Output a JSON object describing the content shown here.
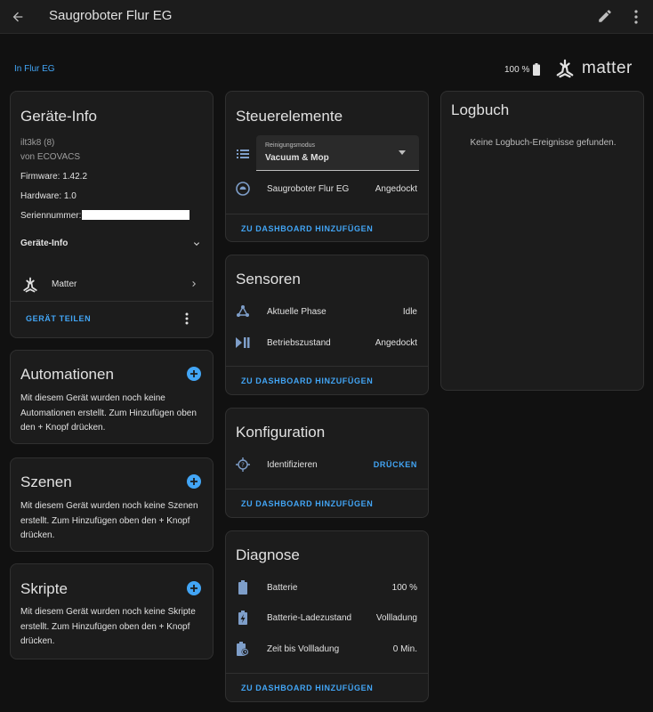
{
  "header": {
    "title": "Saugroboter Flur EG"
  },
  "area": {
    "link": "In Flur EG"
  },
  "battery_top": {
    "value": "100 %"
  },
  "matter_logo": {
    "word": "matter"
  },
  "device_info": {
    "title": "Geräte-Info",
    "model": "ilt3k8 (8)",
    "manufacturer": "von ECOVACS",
    "firmware": "Firmware: 1.42.2",
    "hardware": "Hardware: 1.0",
    "serial_label": "Seriennummer:",
    "section_label": "Geräte-Info",
    "integration": "Matter",
    "share_label": "GERÄT TEILEN"
  },
  "automations": {
    "title": "Automationen",
    "text": "Mit diesem Gerät wurden noch keine Automationen erstellt. Zum Hinzufügen oben den + Knopf drücken."
  },
  "scenes": {
    "title": "Szenen",
    "text": "Mit diesem Gerät wurden noch keine Szenen erstellt. Zum Hinzufügen oben den + Knopf drücken."
  },
  "scripts": {
    "title": "Skripte",
    "text": "Mit diesem Gerät wurden noch keine Skripte erstellt. Zum Hinzufügen oben den + Knopf drücken."
  },
  "controls": {
    "title": "Steuerelemente",
    "select_label": "Reinigungsmodus",
    "select_value": "Vacuum & Mop",
    "vacuum_name": "Saugroboter Flur EG",
    "vacuum_state": "Angedockt",
    "add_label": "ZU DASHBOARD HINZUFÜGEN"
  },
  "sensors": {
    "title": "Sensoren",
    "rows": [
      {
        "name": "Aktuelle Phase",
        "value": "Idle"
      },
      {
        "name": "Betriebszustand",
        "value": "Angedockt"
      }
    ],
    "add_label": "ZU DASHBOARD HINZUFÜGEN"
  },
  "config": {
    "title": "Konfiguration",
    "identify": "Identifizieren",
    "press_label": "DRÜCKEN",
    "add_label": "ZU DASHBOARD HINZUFÜGEN"
  },
  "diagnostics": {
    "title": "Diagnose",
    "rows": [
      {
        "name": "Batterie",
        "value": "100 %"
      },
      {
        "name": "Batterie-Ladezustand",
        "value": "Vollladung"
      },
      {
        "name": "Zeit bis Vollladung",
        "value": "0 Min."
      }
    ],
    "add_label": "ZU DASHBOARD HINZUFÜGEN"
  },
  "logbook": {
    "title": "Logbuch",
    "empty": "Keine Logbuch-Ereignisse gefunden."
  },
  "colors": {
    "accent": "#42a5f5",
    "card": "#1c1c1c",
    "background": "#111111"
  }
}
